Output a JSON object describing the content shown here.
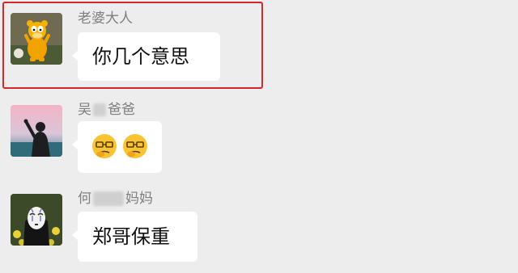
{
  "messages": [
    {
      "sender_name": "老婆大人",
      "text": "你几个意思",
      "avatar_icon": "garfield-avatar-icon"
    },
    {
      "sender_prefix": "吴",
      "sender_suffix": "爸爸",
      "emojis": [
        "thinking-face-emoji",
        "thinking-face-emoji"
      ],
      "avatar_icon": "silhouette-avatar-icon"
    },
    {
      "sender_prefix": "何",
      "sender_suffix": "妈妈",
      "text": "郑哥保重",
      "avatar_icon": "no-face-avatar-icon"
    }
  ],
  "highlight_color": "#d9252c",
  "background_color": "#ededed"
}
